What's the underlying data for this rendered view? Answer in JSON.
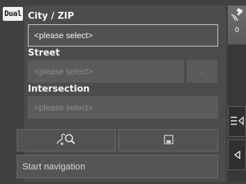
{
  "brand": {
    "logo_text": "Dual"
  },
  "address_form": {
    "city_label": "City / ZIP",
    "city_value": "<please select>",
    "street_label": "Street",
    "street_value": "<please select>",
    "street_extra_button": "-",
    "intersection_label": "Intersection",
    "intersection_value": "<please select>"
  },
  "toolbar": {
    "search_map_icon": "map-search-icon",
    "save_icon": "save-icon",
    "start_navigation_label": "Start navigation"
  },
  "side_panel": {
    "gps_icon": "satellite-icon",
    "satellite_count": "0",
    "menu_icon": "menu-arrow-icon",
    "back_icon": "back-arrow-icon"
  }
}
